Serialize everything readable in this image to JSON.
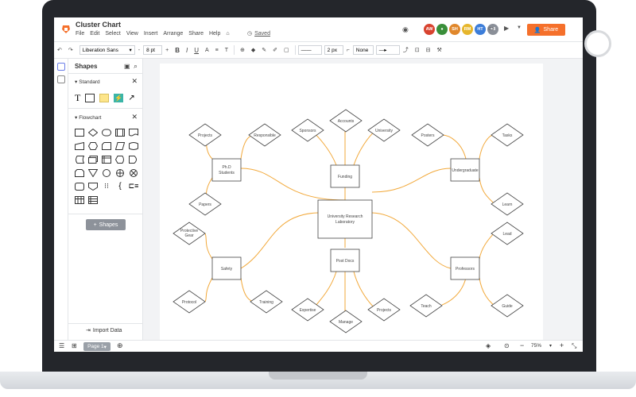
{
  "app": {
    "doc_title": "Cluster Chart",
    "menu": [
      "File",
      "Edit",
      "Select",
      "View",
      "Insert",
      "Arrange",
      "Share",
      "Help"
    ],
    "saved_label": "Saved",
    "collaborators": [
      {
        "initials": "AW",
        "color": "#d8432f"
      },
      {
        "initials": "",
        "color": "#3a8f3a"
      },
      {
        "initials": "SH",
        "color": "#e0872b"
      },
      {
        "initials": "RM",
        "color": "#e6b62c"
      },
      {
        "initials": "HT",
        "color": "#3c7dd9"
      },
      {
        "initials": "+8",
        "color": "#8a8f98"
      }
    ],
    "share_label": "Share"
  },
  "toolbar": {
    "font_name": "Liberation Sans",
    "font_size": "8 pt",
    "bold": "B",
    "italic": "I",
    "underline": "U",
    "line_width": "2 px",
    "endpoint": "None"
  },
  "panel": {
    "title": "Shapes",
    "standard_label": "Standard",
    "flowchart_label": "Flowchart",
    "shapes_button": "Shapes",
    "import_label": "Import Data"
  },
  "bottom": {
    "page_tab": "Page 1",
    "zoom": "75%"
  },
  "diagram": {
    "center": "University Research Laboratory",
    "funding": "Funding",
    "phd": "Ph.D Students",
    "undergrad": "Undergraduate",
    "safety": "Safety",
    "postdocs": "Post Docs",
    "professors": "Professors",
    "projects1": "Projects",
    "responsible": "Responsible",
    "papers": "Papers",
    "sponsors": "Sponsors",
    "accounts": "Accounts",
    "university": "University",
    "posters": "Posters",
    "tasks": "Tasks",
    "learn": "Learn",
    "protective": "Protective Gear",
    "protocol": "Protocol",
    "training": "Training",
    "expertise": "Expertise",
    "manage": "Manage",
    "projects2": "Projects",
    "lead": "Lead",
    "teach": "Teach",
    "guide": "Guide"
  }
}
